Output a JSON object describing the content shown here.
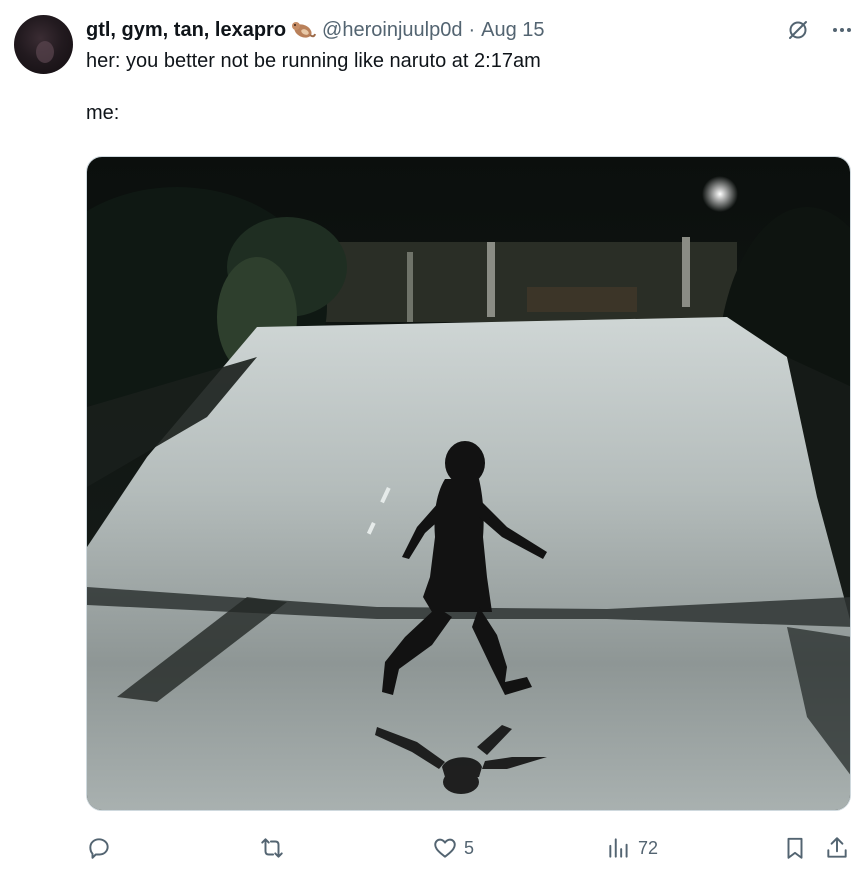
{
  "tweet": {
    "display_name": "gtl, gym, tan, lexapro",
    "emoji": "otter-emoji",
    "handle": "@heroinjuulp0d",
    "separator": "·",
    "date": "Aug 15",
    "text": "her: you better not be running like naruto at 2:17am\n\nme:",
    "media": {
      "description_icon": "photo"
    }
  },
  "actions": {
    "reply_count": "",
    "retweet_count": "",
    "like_count": "5",
    "views_count": "72"
  },
  "colors": {
    "text_primary": "#0f1419",
    "text_secondary": "#536471",
    "border": "#cfd9de"
  }
}
